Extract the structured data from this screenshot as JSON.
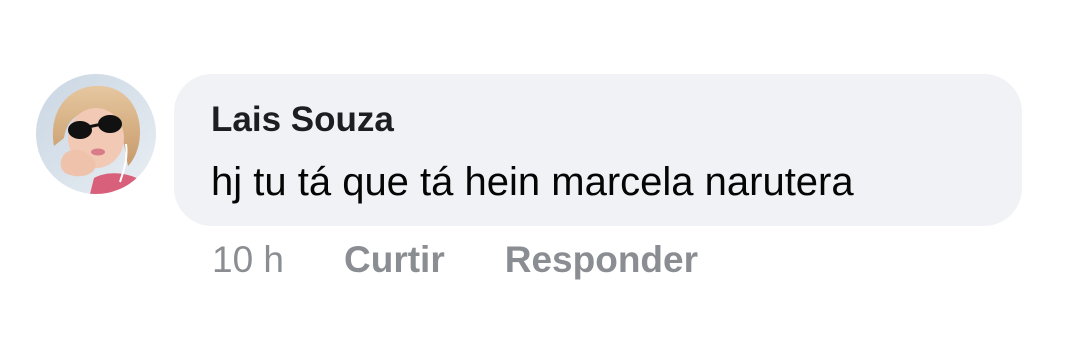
{
  "comment": {
    "author": "Lais Souza",
    "text": "hj tu tá que tá hein marcela narutera",
    "timestamp": "10 h",
    "like_label": "Curtir",
    "reply_label": "Responder"
  },
  "colors": {
    "bubble_bg": "#f0f2f5",
    "author_text": "#1c1e21",
    "body_text": "#050505",
    "meta_text": "#8a8d91"
  },
  "icons": {
    "avatar": "user-avatar-photo"
  }
}
